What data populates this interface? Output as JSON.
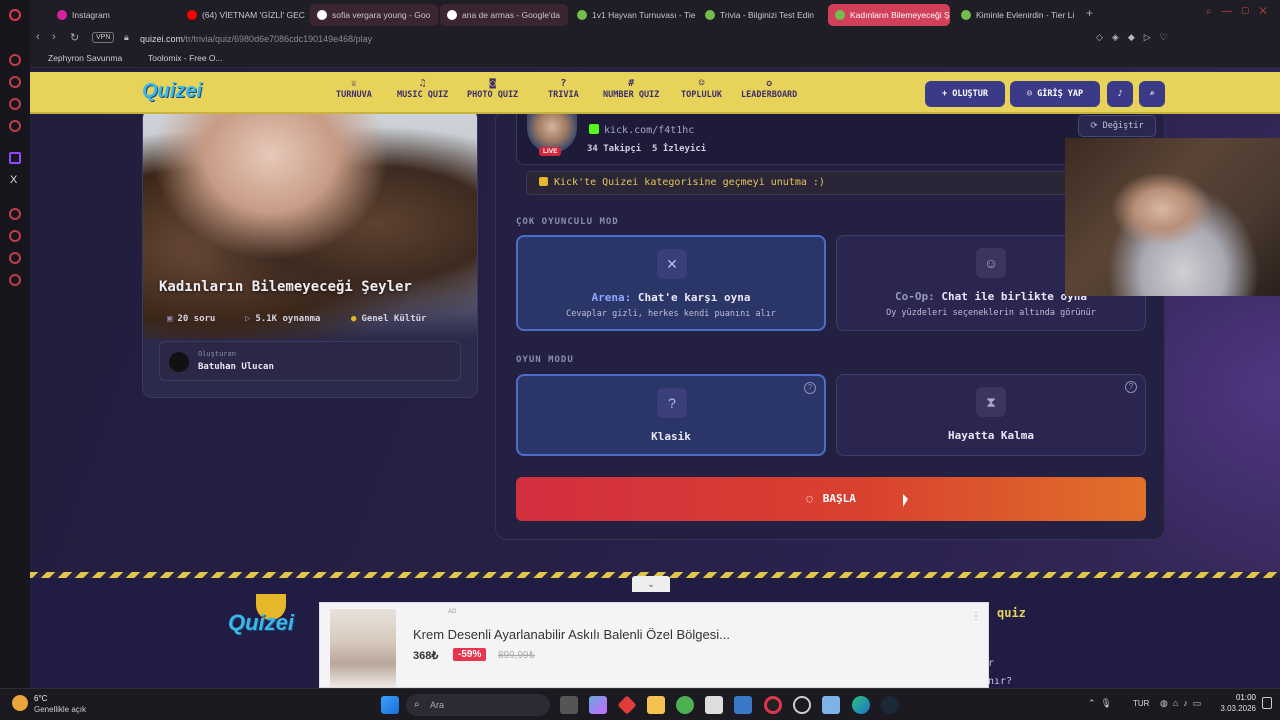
{
  "browser": {
    "tabs": [
      {
        "label": "Instagram",
        "color": "#d6249f"
      },
      {
        "label": "(64) VİETNAM 'GİZLİ' GEC",
        "color": "#ff0000"
      },
      {
        "label": "sofia vergara young - Goo",
        "color": "#ffffff"
      },
      {
        "label": "ana de armas - Google'da",
        "color": "#ffffff"
      },
      {
        "label": "1v1 Hayvan Turnuvası - Tie",
        "color": "#6fbf4a"
      },
      {
        "label": "Trivia - Bilginizi Test Edin",
        "color": "#6fbf4a"
      },
      {
        "label": "Kadınların Bilemeyeceği Ş",
        "color": "#6fbf4a"
      },
      {
        "label": "Kiminle Evlenirdin - Tier Li",
        "color": "#6fbf4a"
      }
    ],
    "url_host": "quizei.com",
    "url_path": "/tr/trivia/quiz/6980d6e7086cdc190149e468/play",
    "vpn_label": "VPN",
    "bookmarks": [
      "Zephyron Savunma",
      "Toolomix - Free O..."
    ]
  },
  "site": {
    "logo": "Quizei",
    "nav": [
      {
        "label": "TURNUVA",
        "icon": "trophy-icon",
        "glyph": "♕"
      },
      {
        "label": "MUSIC QUIZ",
        "icon": "music-icon",
        "glyph": "♫"
      },
      {
        "label": "PHOTO QUIZ",
        "icon": "camera-icon",
        "glyph": "◙"
      },
      {
        "label": "TRIVIA",
        "icon": "question-icon",
        "glyph": "?"
      },
      {
        "label": "NUMBER QUIZ",
        "icon": "hash-icon",
        "glyph": "#"
      },
      {
        "label": "TOPLULUK",
        "icon": "users-icon",
        "glyph": "☺"
      },
      {
        "label": "LEADERBOARD",
        "icon": "medal-icon",
        "glyph": "✪"
      }
    ],
    "create_label": "+ OLUŞTUR",
    "login_label": "GİRİŞ YAP"
  },
  "quiz": {
    "title": "Kadınların Bilemeyeceği Şeyler",
    "questions": "20 soru",
    "plays": "5.1K oynanma",
    "category": "Genel Kültür",
    "creator_label": "Oluşturan",
    "creator_name": "Batuhan Ulucan"
  },
  "streamer": {
    "live_badge": "LIVE",
    "channel": "kick.com/f4t1hc",
    "followers": "34 Takipçi",
    "viewers": "5 İzleyici",
    "change_label": "Değiştir",
    "notice": "Kick'te Quizei kategorisine geçmeyi unutma :)"
  },
  "multiplayer": {
    "label": "ÇOK OYUNCULU MOD",
    "arena": {
      "prefix": "Arena:",
      "title": "Chat'e karşı oyna",
      "desc": "Cevaplar gizli, herkes kendi puanını alır",
      "selected": true
    },
    "coop": {
      "prefix": "Co-Op:",
      "title": "Chat ile birlikte oyna",
      "desc": "Oy yüzdeleri seçeneklerin altında görünür",
      "selected": false
    }
  },
  "gamemode": {
    "label": "OYUN MODU",
    "classic": {
      "title": "Klasik",
      "selected": true
    },
    "survival": {
      "title": "Hayatta Kalma",
      "selected": false
    }
  },
  "start_label": "BAŞLA",
  "footer": {
    "logo": "Quizei",
    "quiz_heading": "quiz",
    "line1": "r",
    "line2": "nır?"
  },
  "ad": {
    "tag": "AD",
    "title": "Krem Desenli Ayarlanabilir Askılı Balenli Özel Bölgesi...",
    "price": "368₺",
    "discount": "-59%",
    "old_price": "899,99₺"
  },
  "taskbar": {
    "temp": "6°C",
    "weather": "Genellikle açık",
    "search_placeholder": "Ara",
    "lang": "TUR",
    "time": "01:00",
    "date": "3.03.2026"
  }
}
